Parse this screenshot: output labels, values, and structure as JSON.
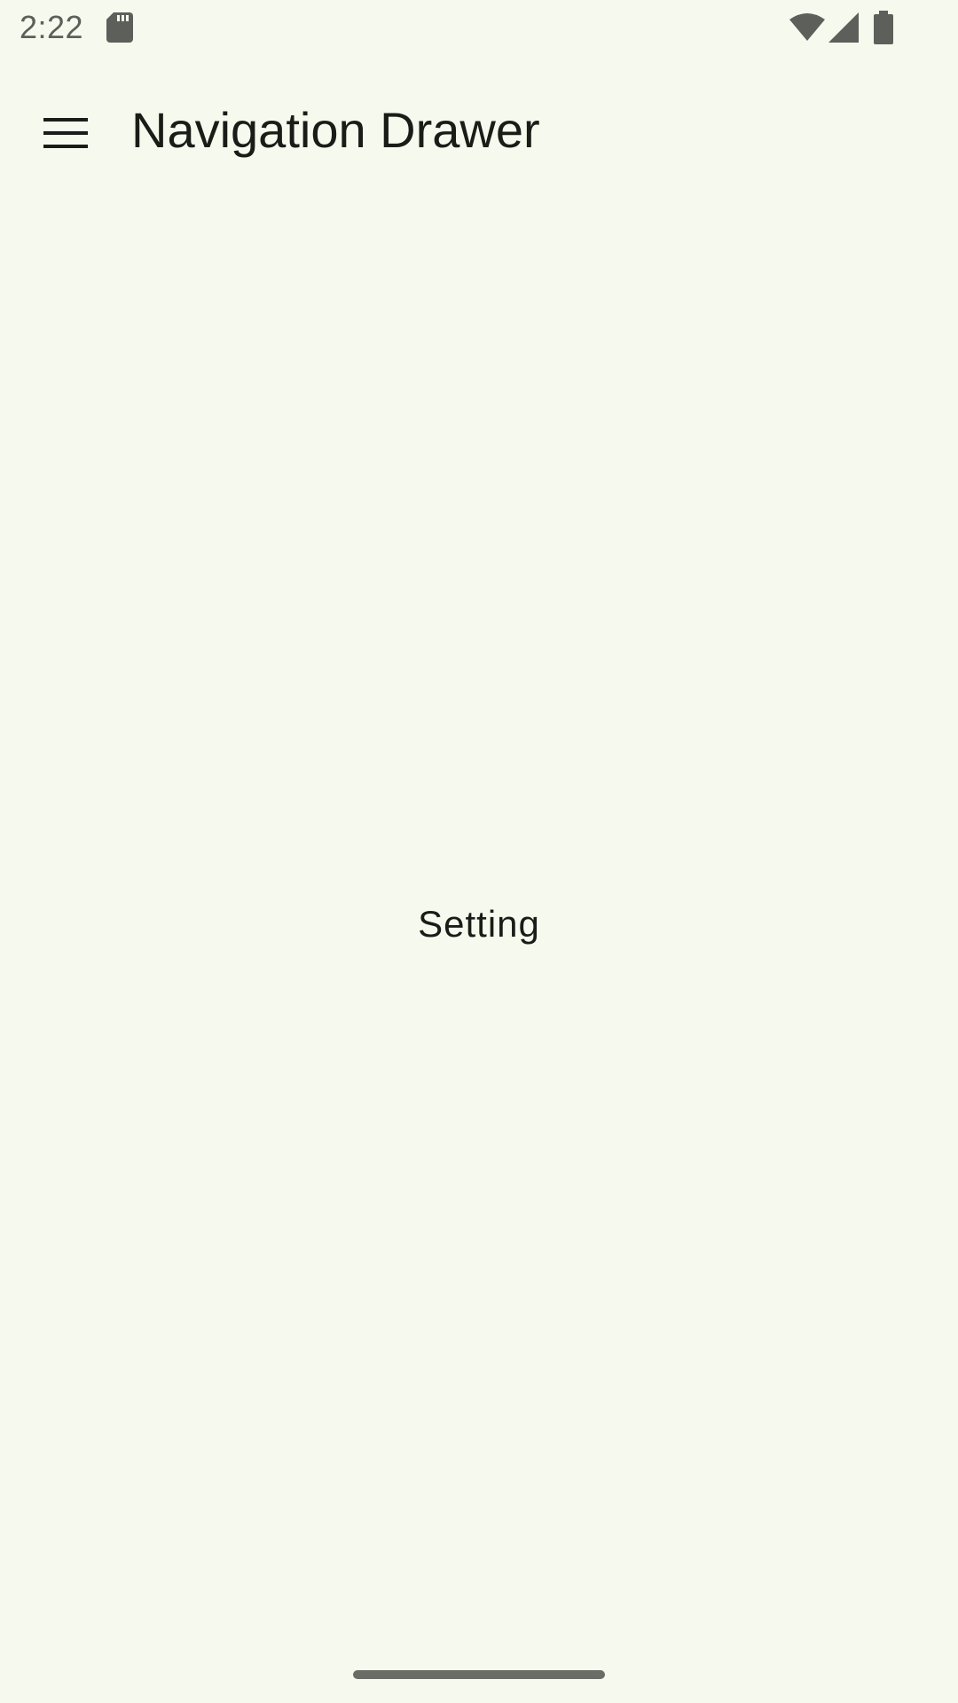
{
  "status_bar": {
    "time": "2:22",
    "icons": [
      "sd-card-icon",
      "wifi-icon",
      "signal-icon",
      "battery-icon"
    ],
    "icon_color": "#5d5f5a"
  },
  "app_bar": {
    "menu_icon": "menu-icon",
    "title": "Navigation Drawer"
  },
  "content": {
    "label": "Setting"
  },
  "colors": {
    "background": "#f6faee",
    "text": "#1a1c18"
  }
}
